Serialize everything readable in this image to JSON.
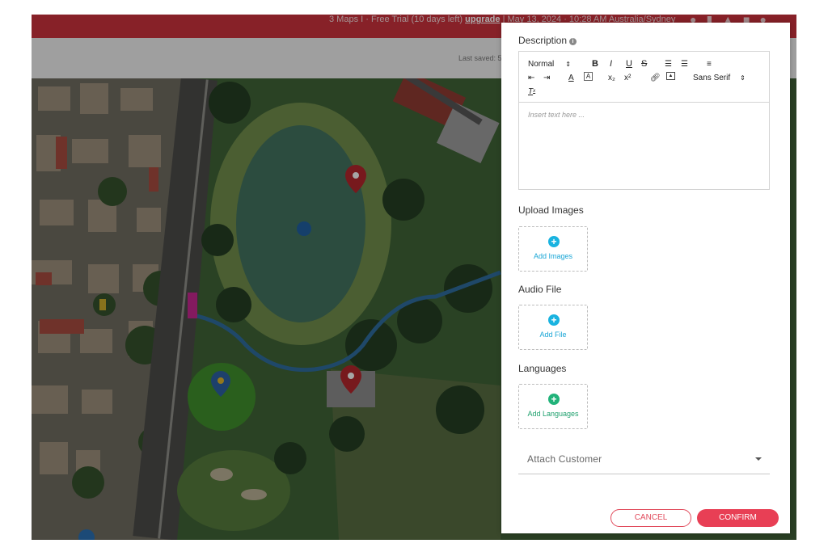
{
  "topbar": {
    "plan_text": "3 Maps I · Free Trial (10 days left) ",
    "upgrade_label": "upgrade",
    "datetime": "  |  May 13, 2024 · 10:28 AM  Australia/Sydney",
    "icons": [
      "help-icon",
      "chart-icon",
      "bell-icon",
      "home-icon",
      "user-avatar"
    ]
  },
  "subbar": {
    "last_saved": "Last saved: 5"
  },
  "modal": {
    "description": {
      "label": "Description",
      "info_glyph": "i",
      "toolbar": {
        "text_style": "Normal",
        "bold": "B",
        "italic": "I",
        "underline": "U",
        "strike": "S",
        "font_family": "Sans Serif",
        "clear_format": "T"
      },
      "placeholder": "Insert text here ..."
    },
    "upload_images": {
      "label": "Upload Images",
      "button": "Add Images"
    },
    "audio_file": {
      "label": "Audio File",
      "button": "Add File"
    },
    "languages": {
      "label": "Languages",
      "button": "Add Languages"
    },
    "attach_customer": {
      "placeholder": "Attach Customer"
    },
    "actions": {
      "cancel": "CANCEL",
      "confirm": "CONFIRM"
    }
  },
  "colors": {
    "brand_red": "#c8313b",
    "confirm_bg": "#e83f55",
    "add_blue": "#19b3e0",
    "add_green": "#21b37a"
  }
}
